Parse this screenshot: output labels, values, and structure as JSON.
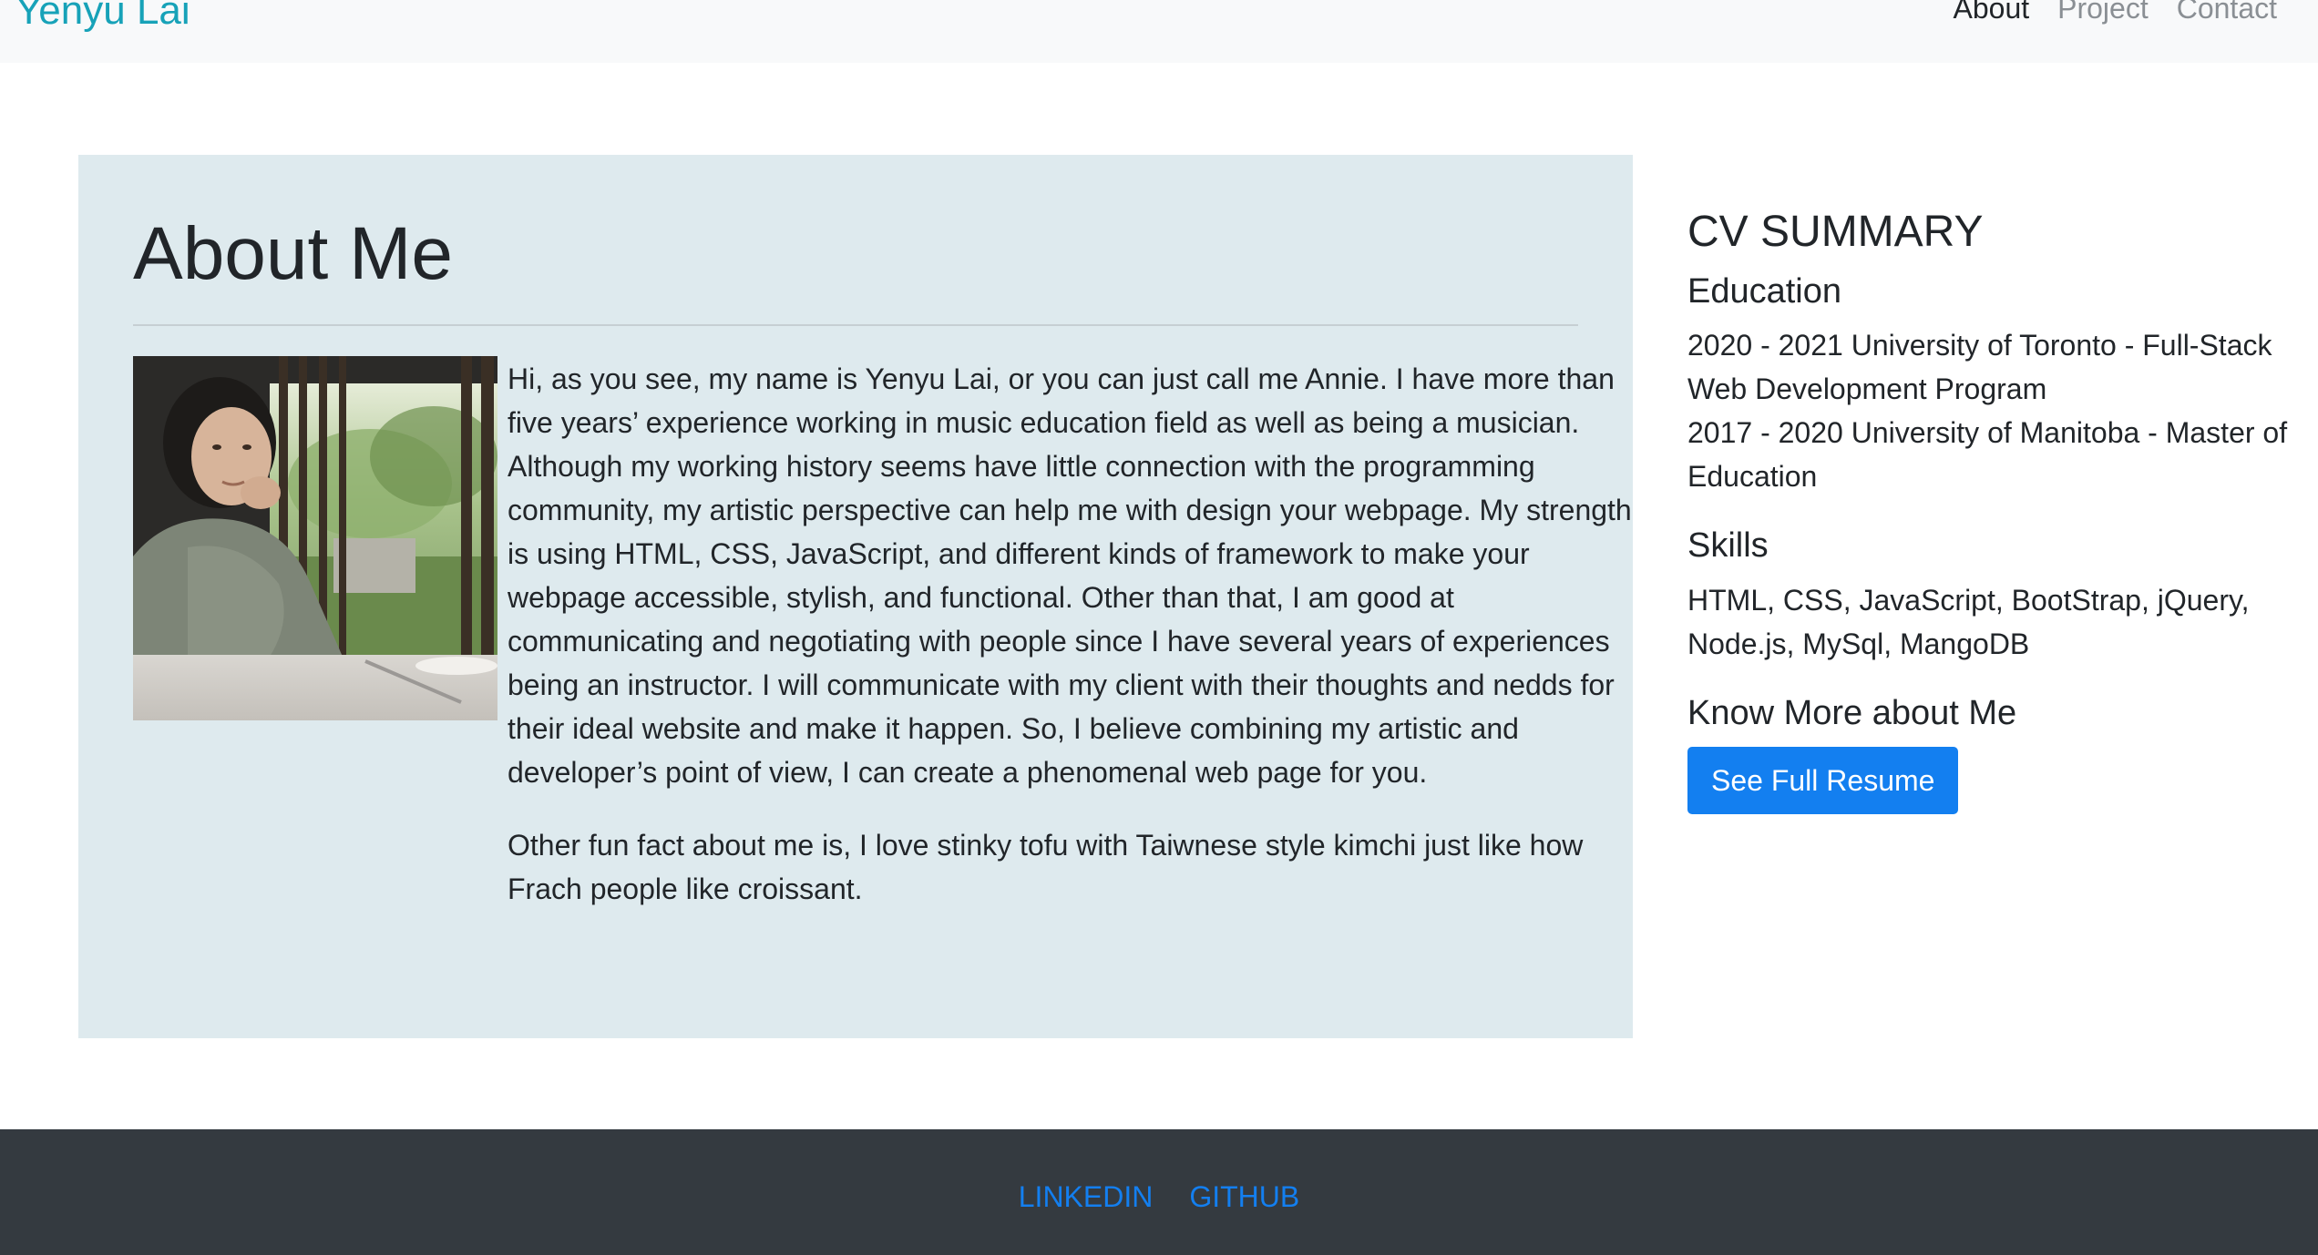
{
  "navbar": {
    "brand": "Yenyu Lai",
    "links": [
      "About",
      "Project",
      "Contact"
    ],
    "active": "About"
  },
  "about": {
    "title": "About Me",
    "photo_alt": "profile photo",
    "paragraphs": [
      "Hi, as you see, my name is Yenyu Lai, or you can just call me Annie. I have more than five years’ experience working in music education field as well as being a musician. Although my working history seems have little connection with the programming community, my artistic perspective can help me with design your webpage. My strength is using HTML, CSS, JavaScript, and different kinds of framework to make your webpage accessible, stylish, and functional. Other than that, I am good at communicating and negotiating with people since I have several years of experiences being an instructor. I will communicate with my client with their thoughts and nedds for their ideal website and make it happen. So, I believe combining my artistic and developer’s point of view, I can create a phenomenal web page for you.",
      "Other fun fact about me is, I love stinky tofu with Taiwnese style kimchi just like how Frach people like croissant."
    ]
  },
  "cv": {
    "title": "CV SUMMARY",
    "education_heading": "Education",
    "education": [
      "2020 - 2021 University of Toronto - Full-Stack Web Development Program",
      "2017 - 2020 University of Manitoba - Master of Education"
    ],
    "skills_heading": "Skills",
    "skills": "HTML, CSS, JavaScript, BootStrap, jQuery, Node.js, MySql, MangoDB",
    "more_heading": "Know More about Me",
    "resume_button": "See Full Resume"
  },
  "footer": {
    "links": [
      "LINKEDIN",
      "GITHUB"
    ]
  },
  "colors": {
    "brand": "#17a2b8",
    "card_bg": "#deeaee",
    "primary": "#137ff0",
    "footer_bg": "#343a40",
    "navbar_bg": "#f8f9fa"
  }
}
